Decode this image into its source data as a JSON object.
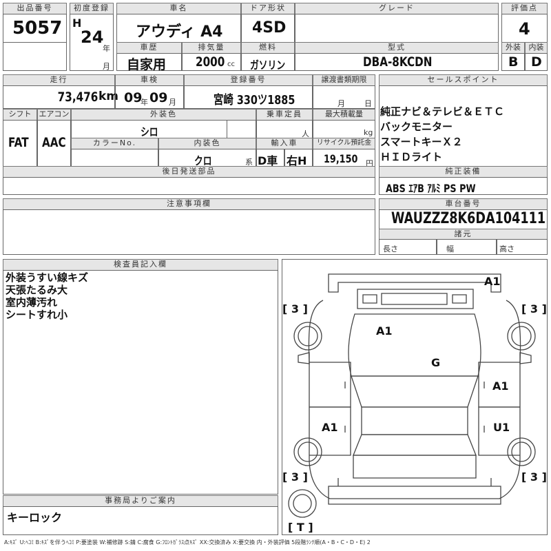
{
  "header": {
    "lot_label": "出品番号",
    "lot_no": "5057",
    "reg_label": "初度登録",
    "era": "H",
    "year": "24",
    "year_unit": "年",
    "month_unit": "月",
    "car_name_label": "車名",
    "car_name": "アウディ A4",
    "door_label": "ドア形状",
    "door": "4SD",
    "grade_label": "グレード",
    "grade": "",
    "score_label": "評価点",
    "score": "4",
    "history_label": "車歴",
    "history": "自家用",
    "displacement_label": "排気量",
    "displacement": "2000",
    "displacement_unit": "cc",
    "fuel_label": "燃料",
    "fuel": "ガソリン",
    "model_label": "型式",
    "model": "DBA-8KCDN",
    "ext_label": "外装",
    "ext_grade": "B",
    "int_label": "内装",
    "int_grade": "D"
  },
  "row2": {
    "mileage_label": "走行",
    "mileage": "73,476",
    "mileage_unit": "km",
    "inspection_label": "車検",
    "insp_year": "09",
    "insp_year_unit": "年",
    "insp_month": "09",
    "insp_month_unit": "月",
    "plate_label": "登録番号",
    "plate": "宮崎 330ツ1885",
    "transfer_label": "譲渡書類期限",
    "transfer_month_unit": "月",
    "transfer_day_unit": "日",
    "shift_label": "シフト",
    "shift": "FAT",
    "ac_label": "エアコン",
    "ac": "AAC",
    "color_label": "外装色",
    "color": "シロ",
    "capacity_label": "乗車定員",
    "capacity_unit": "人",
    "load_label": "最大積載量",
    "load_unit": "kg",
    "color_no_label": "カラーNo.",
    "int_color_label": "内装色",
    "int_color": "クロ",
    "int_color_suffix": "系",
    "import_label": "輸入車",
    "import_dealer": "D車",
    "handle": "右H",
    "recycle_label": "リサイクル預託金",
    "recycle": "19,150",
    "recycle_unit": "円",
    "later_parts_label": "後日発送部品"
  },
  "sales": {
    "label": "セールスポイント",
    "items": [
      "純正ナビ＆テレビ＆ＥＴＣ",
      "バックモニター",
      "スマートキーＸ２",
      "ＨＩＤライト"
    ]
  },
  "equipment": {
    "label": "純正装備",
    "value": "ABS ｴｱB ｱﾙﾐ PS PW"
  },
  "notes": {
    "label": "注意事項欄"
  },
  "chassis": {
    "label": "車台番号",
    "value": "WAUZZZ8K6DA104111",
    "spec_label": "諸元",
    "length_label": "長さ",
    "width_label": "幅",
    "height_label": "高さ"
  },
  "inspector": {
    "label": "検査員記入欄",
    "items": [
      "外装うすい線キズ",
      "天張たるみ大",
      "室内薄汚れ",
      "シートすれ小"
    ]
  },
  "office": {
    "label": "事務局よりご案内",
    "value": "キーロック"
  },
  "diagram": {
    "tire_fl": "[ 3 ]",
    "tire_fr": "[ 3 ]",
    "tire_rl": "[ 3 ]",
    "tire_rr": "[ 3 ]",
    "spare": "[ T ]",
    "marks": [
      {
        "id": "bumper-front",
        "text": "A1"
      },
      {
        "id": "hood",
        "text": "A1"
      },
      {
        "id": "windshield",
        "text": "G"
      },
      {
        "id": "right-front-door",
        "text": "A1"
      },
      {
        "id": "left-rear-door",
        "text": "A1"
      },
      {
        "id": "right-rear-door",
        "text": "U1"
      }
    ]
  },
  "legend": "A:ｷｽﾞ U:ﾍｺﾐ B:ｷｽﾞを伴うﾍｺﾐ P:要塗装 W:補修跡 S:錆 C:腐食 G:ﾌﾛﾝﾄｶﾞﾗｽ点ｷｽﾞ XX:交換済み X:要交換 内・外装評価 5段階ﾗﾝｸ順(A・B・C・D・E) 2"
}
